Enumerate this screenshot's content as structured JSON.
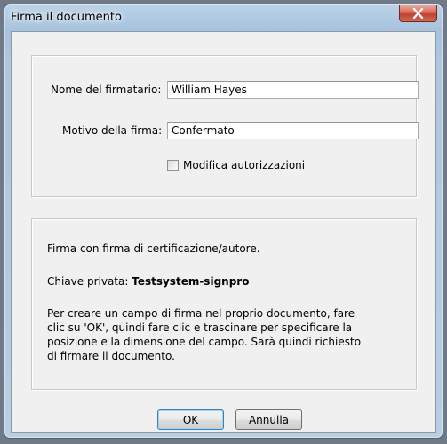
{
  "window": {
    "title": "Firma il documento"
  },
  "form": {
    "signer_label": "Nome del firmatario:",
    "signer_value": "William Hayes",
    "reason_label": "Motivo della firma:",
    "reason_value": "Confermato",
    "permissions_label": "Modifica autorizzazioni",
    "permissions_checked": false
  },
  "info": {
    "line1": "Firma con firma di certificazione/autore.",
    "key_label": "Chiave privata: ",
    "key_value": "Testsystem-signpro",
    "instructions": [
      "Per creare un campo di firma nel proprio documento, fare",
      "clic su 'OK', quindi fare clic e trascinare per specificare la",
      "posizione e la dimensione del campo. Sarà quindi richiesto",
      "di firmare il documento."
    ]
  },
  "buttons": {
    "ok": "OK",
    "cancel": "Annulla"
  },
  "icons": {
    "close": "close-icon"
  }
}
